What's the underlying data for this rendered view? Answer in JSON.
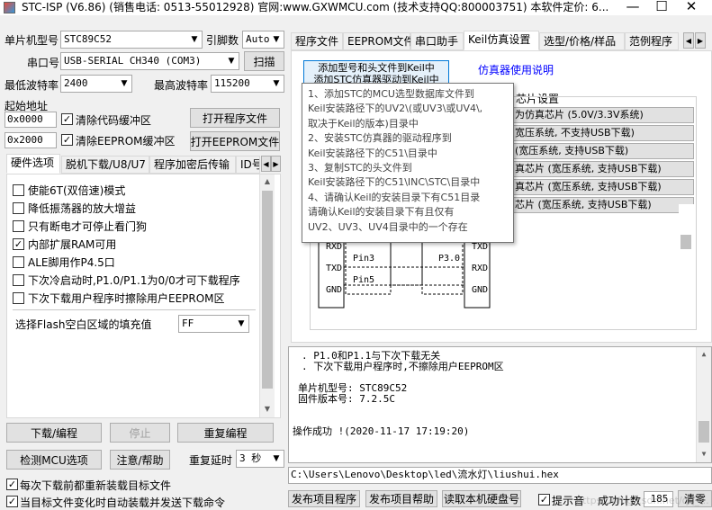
{
  "window": {
    "title": "STC-ISP (V6.86) (销售电话: 0513-55012928) 官网:www.GXWMCU.com  (技术支持QQ:800003751) 本软件定价: 6...",
    "minimize": "—",
    "maximize": "☐",
    "close": "✕"
  },
  "left": {
    "mcu_type_label": "单片机型号",
    "mcu_type_value": "STC89C52",
    "pin_label": "引脚数",
    "pin_value": "Auto",
    "port_label": "串口号",
    "port_value": "USB-SERIAL CH340 (COM3)",
    "scan_btn": "扫描",
    "min_baud_label": "最低波特率",
    "min_baud_value": "2400",
    "max_baud_label": "最高波特率",
    "max_baud_value": "115200",
    "start_addr_label": "起始地址",
    "addr1": "0x0000",
    "clear_code_label": "清除代码缓冲区",
    "open_prog_btn": "打开程序文件",
    "addr2": "0x2000",
    "clear_eeprom_label": "清除EEPROM缓冲区",
    "open_eeprom_btn": "打开EEPROM文件",
    "tabs": [
      "硬件选项",
      "脱机下载/U8/U7",
      "程序加密后传输",
      "ID号"
    ],
    "options": [
      {
        "label": "使能6T(双倍速)模式",
        "checked": false
      },
      {
        "label": "降低振荡器的放大增益",
        "checked": false
      },
      {
        "label": "只有断电才可停止看门狗",
        "checked": false
      },
      {
        "label": "内部扩展RAM可用",
        "checked": true
      },
      {
        "label": "ALE脚用作P4.5口",
        "checked": false
      },
      {
        "label": "下次冷启动时,P1.0/P1.1为0/0才可下载程序",
        "checked": false
      },
      {
        "label": "下次下载用户程序时擦除用户EEPROM区",
        "checked": false
      }
    ],
    "fill_label": "选择Flash空白区域的填充值",
    "fill_value": "FF",
    "download_btn": "下载/编程",
    "stop_btn": "停止",
    "reprogram_btn": "重复编程",
    "detect_btn": "检测MCU选项",
    "help_btn": "注意/帮助",
    "delay_label": "重复延时",
    "delay_value": "3 秒",
    "reload_label": "每次下载前都重新装载目标文件",
    "auto_label": "当目标文件变化时自动装载并发送下载命令"
  },
  "right": {
    "tabs": [
      "程序文件",
      "EEPROM文件",
      "串口助手",
      "Keil仿真设置",
      "选型/价格/样品",
      "范例程序"
    ],
    "add_btn_line1": "添加型号和头文件到Keil中",
    "add_btn_line2": "添加STC仿真器驱动到Keil中",
    "sim_help_link": "仿真器使用说明",
    "chip_group_label": "芯片设置",
    "chip_buttons": [
      "为仿真芯片 (5.0V/3.3V系统)",
      "宽压系统, 不支持USB下载)",
      "(宽压系统, 支持USB下载)",
      "真芯片 (宽压系统, 支持USB下载)",
      "真芯片 (宽压系统, 支持USB下载)",
      "芯片 (宽压系统, 支持USB下载)"
    ],
    "diagram": {
      "left_pins": [
        "RXD",
        "TXD",
        "GND"
      ],
      "right_pins": [
        "TXD",
        "RXD",
        "GND"
      ],
      "mid1": "Pin3",
      "mid2": "Pin5",
      "mid3": "P3.0"
    },
    "tooltip": [
      "1、添加STC的MCU选型数据库文件到",
      "    Keil安装路径下的UV2\\(或UV3\\或UV4\\,",
      "    取决于Keil的版本)目录中",
      "2、安装STC仿真器的驱动程序到",
      "    Keil安装路径下的C51\\目录中",
      "3、复制STC的头文件到",
      "    Keil安装路径下的C51\\INC\\STC\\目录中",
      "4、请确认Keil的安装目录下有C51目录",
      "    请确认Keil的安装目录下有且仅有",
      "    UV2、UV3、UV4目录中的一个存在"
    ],
    "log": [
      ". P1.0和P1.1与下次下载无关",
      ". 下次下载用户程序时,不擦除用户EEPROM区",
      "",
      "  单片机型号: STC89C52",
      "  固件版本号: 7.2.5C",
      "",
      "",
      "操作成功 !(2020-11-17 17:19:20)"
    ],
    "path": "C:\\Users\\Lenovo\\Desktop\\led\\流水灯\\liushui.hex",
    "publish_btn": "发布项目程序",
    "publish_help_btn": "发布项目帮助",
    "read_serial_btn": "读取本机硬盘号",
    "beep_label": "提示音",
    "success_label": "成功计数",
    "success_count": "185",
    "clear_btn": "清零",
    "watermark": "https://blog.csdn.net/qq_..."
  }
}
